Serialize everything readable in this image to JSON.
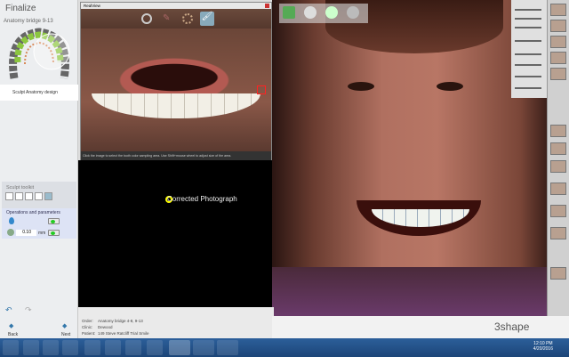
{
  "left_panel": {
    "title": "Finalize",
    "subtitle": "Anatomy bridge 9-13",
    "step": "Sculpt Anatomy design",
    "toolkit_title": "Sculpt toolkit",
    "ops_title": "Operations and parameters",
    "thickness_value": "0.10",
    "unit": "mm",
    "back": "Back",
    "next": "Next"
  },
  "realview": {
    "title": "RealView",
    "caption": "Click the image to select the tooth color sampling area. Use Shift+mouse wheel to adjust size of the area."
  },
  "overlay": {
    "label": "Corrected Photograph"
  },
  "info": {
    "order_label": "Order:",
    "order": "Anatomy bridge 4-8, 9-13",
    "clinic_label": "Clinic:",
    "clinic": "Dewood",
    "patient_label": "Patient:",
    "patient": "149 Steve Ratcliff Trial Smile"
  },
  "brand": "3shape",
  "taskbar": {
    "time": "12:10 PM",
    "date": "4/20/2016"
  },
  "colors": {
    "accent": "#2c5f9a",
    "tooth_green": "#8cc63f"
  }
}
